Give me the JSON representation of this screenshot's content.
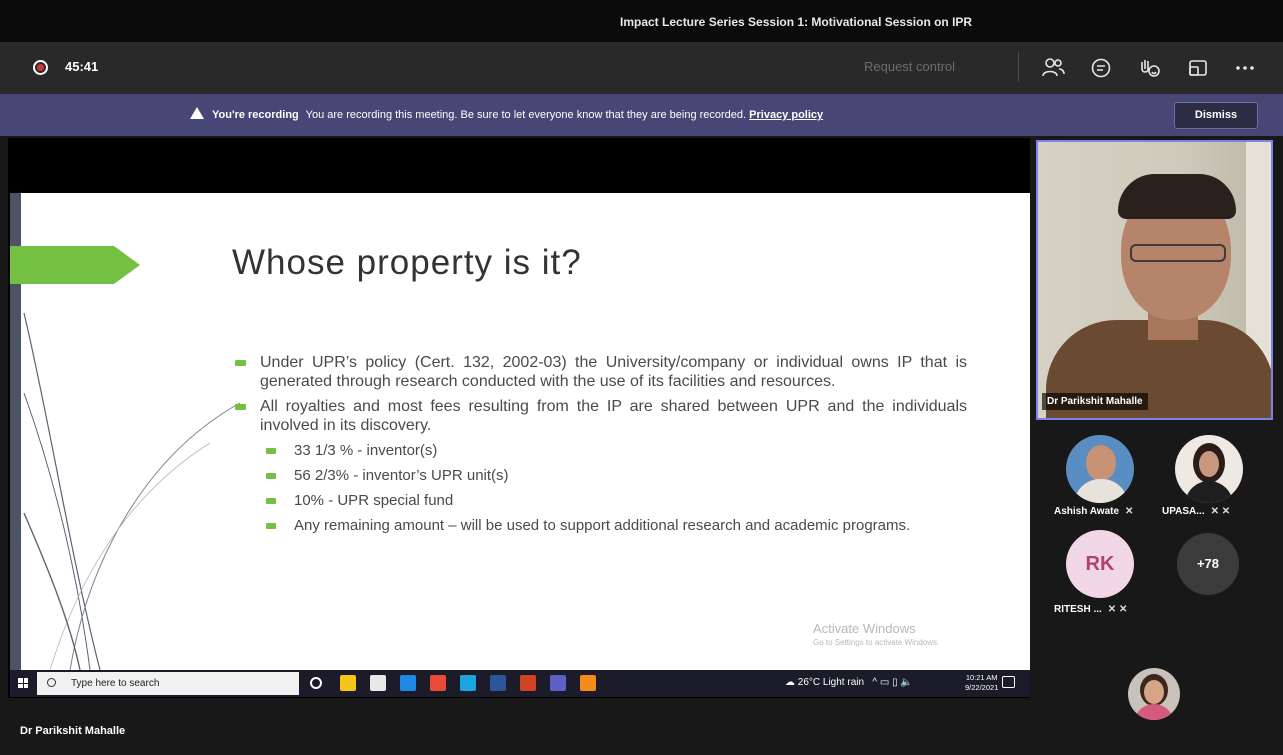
{
  "window": {
    "title": "Impact Lecture Series Session 1: Motivational Session on IPR"
  },
  "toolbar": {
    "timer": "45:41",
    "request_control": "Request control",
    "icons": [
      "participants-icon",
      "chat-icon",
      "reactions-icon",
      "share-tray-icon",
      "more-options-icon"
    ]
  },
  "banner": {
    "bold": "You're recording",
    "message": "You are recording this meeting. Be sure to let everyone know that they are being recorded.",
    "link": "Privacy policy",
    "dismiss": "Dismiss"
  },
  "slide": {
    "title": "Whose property is it?",
    "bullets": [
      "Under UPR’s policy (Cert. 132, 2002-03) the University/company or individual owns IP that is generated through research conducted with the use of its facilities and resources.",
      "All royalties and most fees resulting from the IP are shared between UPR and the individuals involved in its discovery."
    ],
    "sub_bullets": [
      "33 1/3 % - inventor(s)",
      "56 2/3% - inventor’s UPR unit(s)",
      "10% - UPR special fund",
      "Any remaining amount – will be used to support additional research and academic programs."
    ],
    "watermark_title": "Activate Windows",
    "watermark_sub": "Go to Settings to activate Windows."
  },
  "taskbar": {
    "search_placeholder": "Type here to search",
    "weather": "26°C  Light rain",
    "time": "10:21 AM",
    "date": "9/22/2021",
    "app_colors": [
      "#ffffff",
      "#f5c518",
      "#e8e8e8",
      "#1e88e5",
      "#e94b35",
      "#1aa7e0",
      "#2b579a",
      "#d04423",
      "#5b5fc7",
      "#f38b1d"
    ]
  },
  "presenter": {
    "name": "Dr Parikshit Mahalle"
  },
  "video": {
    "label": "Dr Parikshit Mahalle"
  },
  "participants": [
    {
      "name": "Ashish Awate",
      "initials": ""
    },
    {
      "name": "UPASA...",
      "initials": ""
    },
    {
      "name": "RITESH ...",
      "initials": "RK"
    },
    {
      "name": "",
      "initials": "+78"
    }
  ]
}
